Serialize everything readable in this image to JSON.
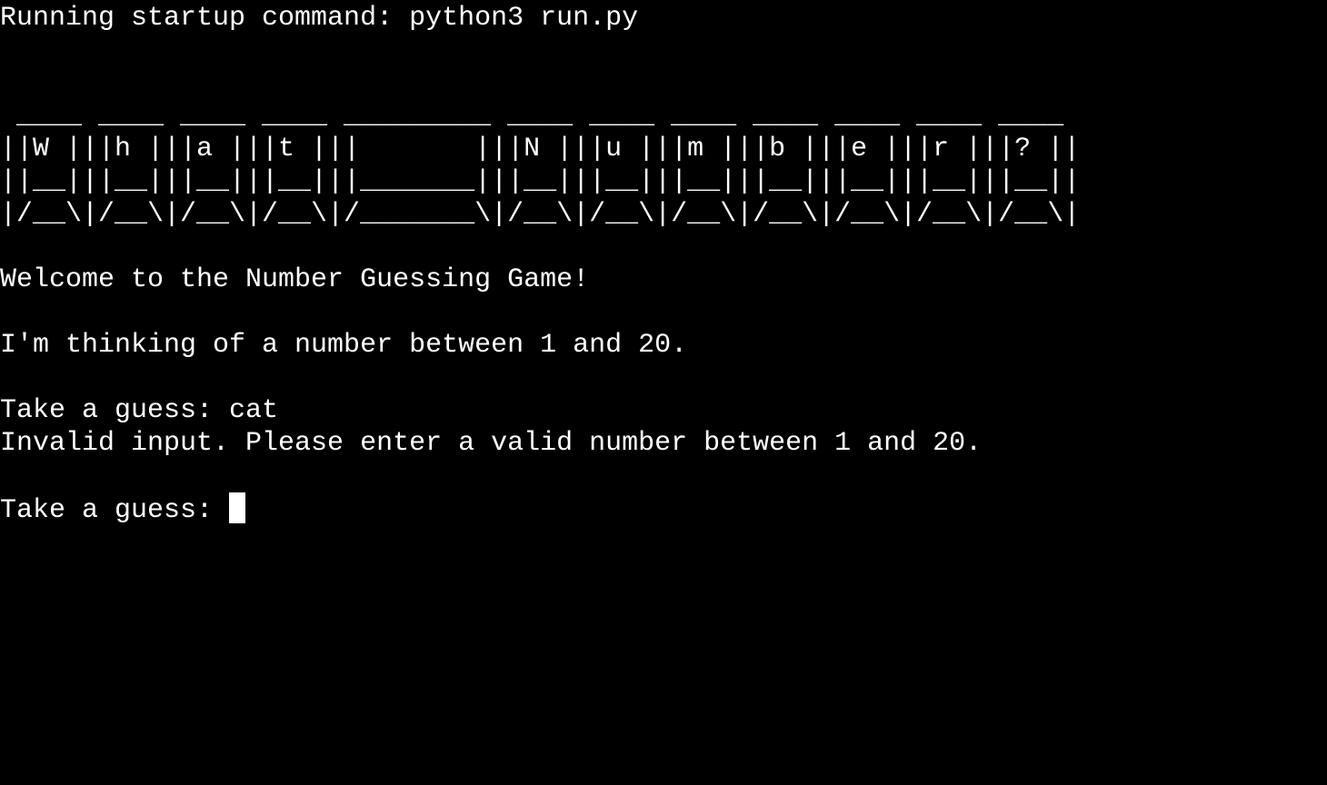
{
  "terminal": {
    "startup_line": "Running startup command: python3 run.py",
    "banner_lines": [
      " ____ ____ ____ ____ _________ ____ ____ ____ ____ ____ ____ ____",
      "||W |||h |||a |||t |||       |||N |||u |||m |||b |||e |||r |||? ||",
      "||__|||__|||__|||__|||_______|||__|||__|||__|||__|||__|||__|||__||",
      "|/__\\|/__\\|/__\\|/__\\|/_______\\|/__\\|/__\\|/__\\|/__\\|/__\\|/__\\|/__\\|"
    ],
    "welcome": "Welcome to the Number Guessing Game!",
    "thinking": "I'm thinking of a number between 1 and 20.",
    "guess1_prompt": "Take a guess: cat",
    "invalid_msg": "Invalid input. Please enter a valid number between 1 and 20.",
    "guess2_prompt": "Take a guess: "
  }
}
